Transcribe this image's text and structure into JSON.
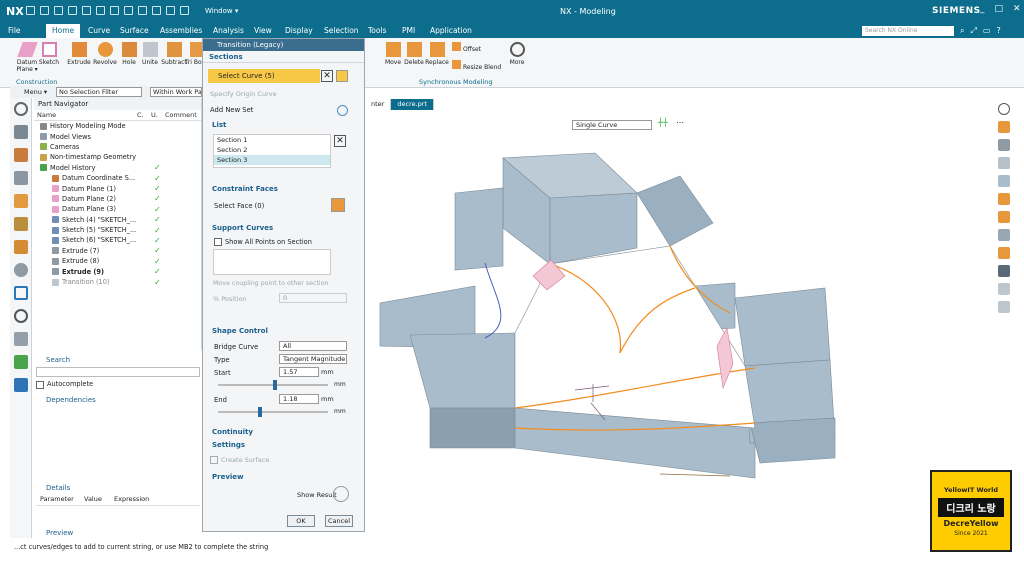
{
  "window": {
    "logo": "NX",
    "menu": "Window ▾",
    "title": "NX - Modeling",
    "brand": "SIEMENS",
    "controls": [
      "_",
      "□",
      "✕"
    ]
  },
  "menubar": {
    "tabs": [
      "File",
      "Home",
      "Curve",
      "Surface",
      "Assemblies",
      "Analysis",
      "View",
      "Display",
      "Selection",
      "Tools",
      "PMI",
      "Application"
    ],
    "active": "Home",
    "search_placeholder": "Search NX Online"
  },
  "ribbon": {
    "buttons": [
      {
        "label": "Datum Plane ▾",
        "icon": "datum-plane-icon"
      },
      {
        "label": "Sketch",
        "icon": "sketch-icon"
      },
      {
        "label": "Extrude",
        "icon": "extrude-icon"
      },
      {
        "label": "Revolve",
        "icon": "revolve-icon"
      },
      {
        "label": "Hole",
        "icon": "hole-icon"
      },
      {
        "label": "Unite",
        "icon": "unite-icon"
      },
      {
        "label": "Subtract",
        "icon": "subtract-icon"
      },
      {
        "label": "Tri Body",
        "icon": "trim-body-icon"
      },
      {
        "label": "Move",
        "icon": "move-face-icon"
      },
      {
        "label": "Delete",
        "icon": "delete-face-icon"
      },
      {
        "label": "Replace",
        "icon": "replace-face-icon"
      },
      {
        "label": "Offset",
        "icon": "offset-icon"
      },
      {
        "label": "Resize Blend",
        "icon": "resize-blend-icon"
      },
      {
        "label": "More",
        "icon": "more-icon"
      }
    ],
    "groups": [
      "Construction",
      "Synchronous Modeling"
    ]
  },
  "topnav": {
    "menu": "Menu ▾",
    "filter": "No Selection Filter",
    "scope": "Within Work Part"
  },
  "part_navigator": {
    "title": "Part Navigator",
    "columns": [
      "Name",
      "C.",
      "U.",
      "Comment"
    ],
    "rows": [
      {
        "label": "History Modeling Mode",
        "check": false
      },
      {
        "label": "Model Views",
        "check": false
      },
      {
        "label": "Cameras",
        "check": false
      },
      {
        "label": "Non-timestamp Geometry",
        "check": false
      },
      {
        "label": "Model History",
        "check": true
      },
      {
        "label": "Datum Coordinate S...",
        "check": true
      },
      {
        "label": "Datum Plane (1)",
        "check": true
      },
      {
        "label": "Datum Plane (2)",
        "check": true
      },
      {
        "label": "Datum Plane (3)",
        "check": true
      },
      {
        "label": "Sketch (4) \"SKETCH_...",
        "check": true
      },
      {
        "label": "Sketch (5) \"SKETCH_...",
        "check": true
      },
      {
        "label": "Sketch (6) \"SKETCH_...",
        "check": true
      },
      {
        "label": "Extrude (7)",
        "check": true
      },
      {
        "label": "Extrude (8)",
        "check": true
      },
      {
        "label": "Extrude (9)",
        "check": true
      },
      {
        "label": "Transition (10)",
        "check": true
      }
    ]
  },
  "lower_panels": {
    "search": "Search",
    "autocomplete": "Autocomplete",
    "dependencies": "Dependencies",
    "details": "Details",
    "detail_cols": [
      "Parameter",
      "Value",
      "Expression"
    ],
    "preview": "Preview"
  },
  "dialog": {
    "title": "Transition (Legacy)",
    "sections": "Sections",
    "select_curve": "Select Curve (5)",
    "origin_curve": "Specify Origin Curve",
    "add_new_set": "Add New Set",
    "list_label": "List",
    "list": [
      "Section 1",
      "Section 2",
      "Section 3"
    ],
    "constraint_faces": "Constraint Faces",
    "select_face": "Select Face (0)",
    "support_curves": "Support Curves",
    "show_all_points": "Show All Points on Section",
    "move_coupling": "Move coupling point to other section",
    "position_label": "% Position",
    "position_value": "0",
    "shape_control": "Shape Control",
    "bridge_curve_label": "Bridge Curve",
    "bridge_curve": "All",
    "type_label": "Type",
    "type": "Tangent Magnitude",
    "start_label": "Start",
    "start": "1.57",
    "end_label": "End",
    "end": "1.18",
    "unit": "mm",
    "continuity": "Continuity",
    "settings": "Settings",
    "create_surface": "Create Surface",
    "preview": "Preview",
    "show_result": "Show Result",
    "ok": "OK",
    "cancel": "Cancel"
  },
  "viewport": {
    "tabs": [
      "nter",
      "decre.prt"
    ],
    "active_tab": "decre.prt",
    "selection_mode": "Single Curve"
  },
  "status": "...ct curves/edges to add to current string, or use MB2 to complete the string",
  "badge": {
    "top": "YellowIT World",
    "ko": "디크리 노랑",
    "en": "DecreYellow",
    "since": "Since 2021"
  },
  "colors": {
    "title": "#0c6e8c",
    "body": "#a9bccb",
    "highlight": "#f28c1e",
    "badge": "#ffcc00"
  }
}
